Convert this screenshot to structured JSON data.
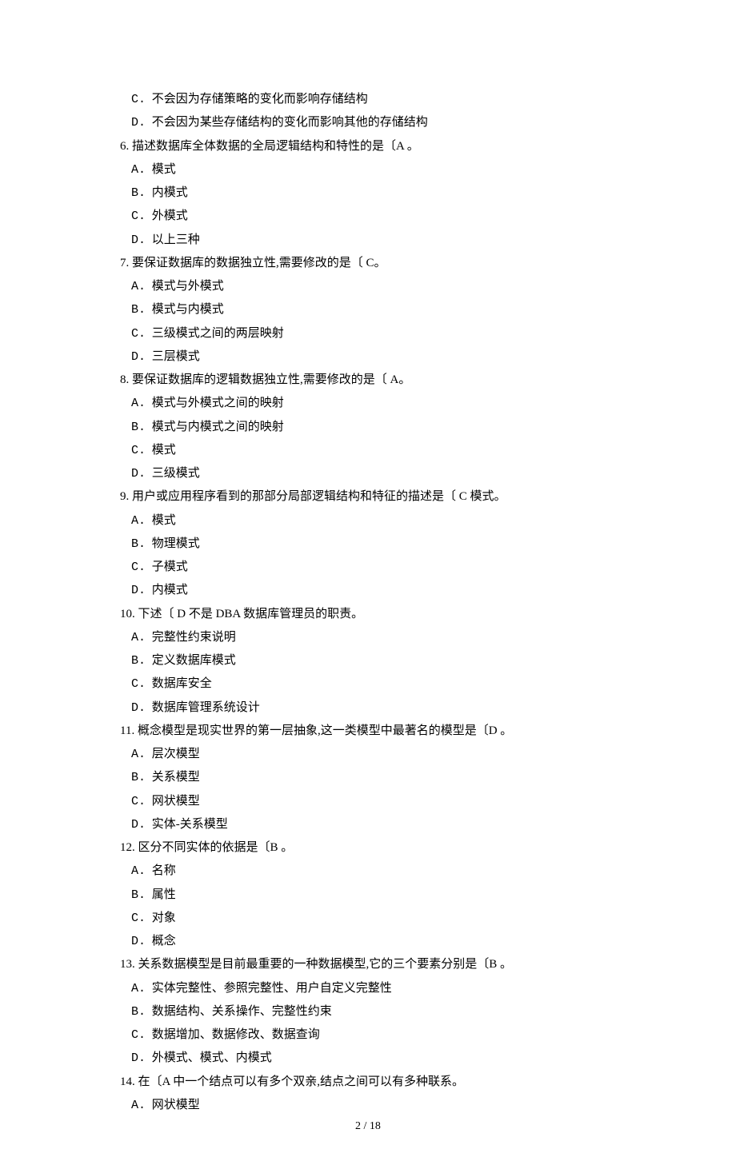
{
  "prefix_options": [
    {
      "label": "C.",
      "text": "不会因为存储策略的变化而影响存储结构"
    },
    {
      "label": "D.",
      "text": "不会因为某些存储结构的变化而影响其他的存储结构"
    }
  ],
  "questions": [
    {
      "num": "6.",
      "stem": "描述数据库全体数据的全局逻辑结构和特性的是〔A 。",
      "options": [
        {
          "label": "A.",
          "text": "模式"
        },
        {
          "label": "B.",
          "text": "内模式"
        },
        {
          "label": "C.",
          "text": "外模式"
        },
        {
          "label": "D.",
          "text": "以上三种"
        }
      ]
    },
    {
      "num": "7.",
      "stem": "要保证数据库的数据独立性,需要修改的是〔 C。",
      "options": [
        {
          "label": "A.",
          "text": "模式与外模式"
        },
        {
          "label": "B.",
          "text": "模式与内模式"
        },
        {
          "label": "C.",
          "text": "三级模式之间的两层映射"
        },
        {
          "label": "D.",
          "text": "三层模式"
        }
      ]
    },
    {
      "num": "8.",
      "stem": "要保证数据库的逻辑数据独立性,需要修改的是〔 A。",
      "options": [
        {
          "label": "A.",
          "text": "模式与外模式之间的映射"
        },
        {
          "label": "B.",
          "text": "模式与内模式之间的映射"
        },
        {
          "label": "C.",
          "text": "模式"
        },
        {
          "label": "D.",
          "text": "三级模式"
        }
      ]
    },
    {
      "num": "9.",
      "stem": "用户或应用程序看到的那部分局部逻辑结构和特征的描述是〔 C 模式。",
      "options": [
        {
          "label": "A.",
          "text": "模式"
        },
        {
          "label": "B.",
          "text": "物理模式"
        },
        {
          "label": "C.",
          "text": "子模式"
        },
        {
          "label": "D.",
          "text": "内模式"
        }
      ]
    },
    {
      "num": "10.",
      "stem": "下述〔 D 不是 DBA 数据库管理员的职责。",
      "options": [
        {
          "label": "A.",
          "text": "完整性约束说明"
        },
        {
          "label": "B.",
          "text": "定义数据库模式"
        },
        {
          "label": "C.",
          "text": "数据库安全"
        },
        {
          "label": "D.",
          "text": "数据库管理系统设计"
        }
      ]
    },
    {
      "num": "11.",
      "stem": "概念模型是现实世界的第一层抽象,这一类模型中最著名的模型是〔D 。",
      "options": [
        {
          "label": "A.",
          "text": "层次模型"
        },
        {
          "label": "B.",
          "text": "关系模型"
        },
        {
          "label": "C.",
          "text": "网状模型"
        },
        {
          "label": "D.",
          "text": "实体-关系模型"
        }
      ]
    },
    {
      "num": "12.",
      "stem": "区分不同实体的依据是〔B 。",
      "options": [
        {
          "label": "A.",
          "text": "名称"
        },
        {
          "label": "B.",
          "text": "属性"
        },
        {
          "label": "C.",
          "text": "对象"
        },
        {
          "label": "D.",
          "text": "概念"
        }
      ]
    },
    {
      "num": "13.",
      "stem": "关系数据模型是目前最重要的一种数据模型,它的三个要素分别是〔B 。",
      "options": [
        {
          "label": "A.",
          "text": "实体完整性、参照完整性、用户自定义完整性"
        },
        {
          "label": "B.",
          "text": "数据结构、关系操作、完整性约束"
        },
        {
          "label": "C.",
          "text": "数据增加、数据修改、数据查询"
        },
        {
          "label": "D.",
          "text": "外模式、模式、内模式"
        }
      ]
    },
    {
      "num": "14.",
      "stem": "在〔A 中一个结点可以有多个双亲,结点之间可以有多种联系。",
      "options": [
        {
          "label": "A.",
          "text": "网状模型"
        }
      ]
    }
  ],
  "footer": "2 / 18"
}
